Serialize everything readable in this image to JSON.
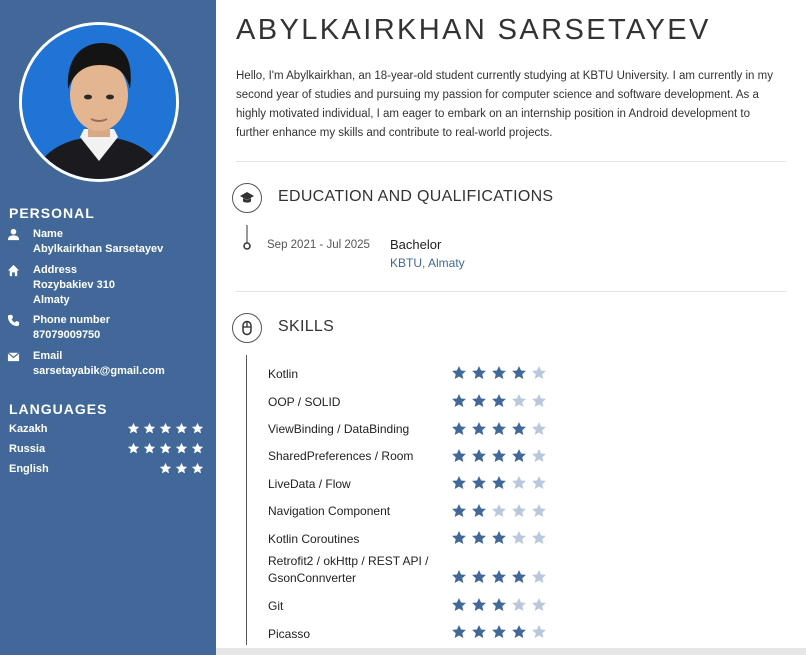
{
  "colors": {
    "sidebar": "#416898",
    "accent": "#416898",
    "star_on": "#416898",
    "star_off": "#b9c8dc"
  },
  "profile": {
    "name": "ABYLKAIRKHAN SARSETAYEV",
    "photo": "profile-photo",
    "bio": "Hello, I'm Abylkairkhan, an 18-year-old student currently studying at KBTU University. I am currently in my second year of studies and pursuing my passion for computer science and software development. As a highly motivated individual, I am eager to embark on an internship position in Android development to further enhance my skills and contribute to real-world projects."
  },
  "personal": {
    "heading": "PERSONAL",
    "items": [
      {
        "icon": "person-icon",
        "label": "Name",
        "value": "Abylkairkhan Sarsetayev"
      },
      {
        "icon": "home-icon",
        "label": "Address",
        "value": "Rozybakiev 310",
        "value2": "Almaty"
      },
      {
        "icon": "phone-icon",
        "label": "Phone number",
        "value": "87079009750"
      },
      {
        "icon": "mail-icon",
        "label": "Email",
        "value": "sarsetayabik@gmail.com"
      }
    ]
  },
  "languages": {
    "heading": "LANGUAGES",
    "items": [
      {
        "name": "Kazakh",
        "stars": 5
      },
      {
        "name": "Russia",
        "stars": 5
      },
      {
        "name": "English",
        "stars": 3
      }
    ]
  },
  "education": {
    "title": "EDUCATION AND QUALIFICATIONS",
    "icon": "graduation-cap-icon",
    "items": [
      {
        "date": "Sep 2021 - Jul 2025",
        "degree": "Bachelor",
        "place": "KBTU, Almaty"
      }
    ]
  },
  "skills": {
    "title": "SKILLS",
    "icon": "mouse-icon",
    "max": 5,
    "items": [
      {
        "name": "Kotlin",
        "rating": 4
      },
      {
        "name": "OOP / SOLID",
        "rating": 3
      },
      {
        "name": "ViewBinding / DataBinding",
        "rating": 4
      },
      {
        "name": "SharedPreferences / Room",
        "rating": 4
      },
      {
        "name": "LiveData / Flow",
        "rating": 3
      },
      {
        "name": "Navigation Component",
        "rating": 2
      },
      {
        "name": "Kotlin Coroutines",
        "rating": 3
      },
      {
        "name": "Retrofit2 / okHttp / REST API / GsonConnverter",
        "rating": 4
      },
      {
        "name": "Git",
        "rating": 3
      },
      {
        "name": "Picasso",
        "rating": 4
      }
    ]
  }
}
